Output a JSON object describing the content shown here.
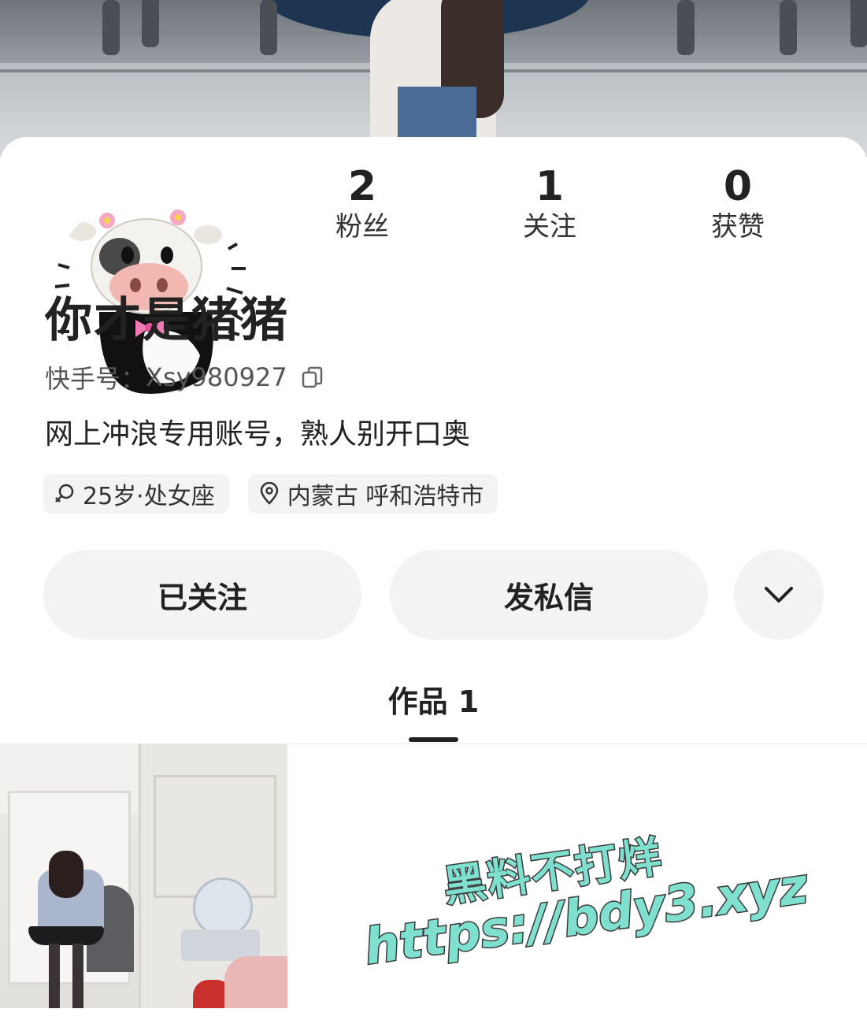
{
  "profile": {
    "nickname": "你才是猪猪",
    "kuaishou_id_label": "快手号：",
    "kuaishou_id": "Xsy980927",
    "bio": "网上冲浪专用账号，熟人别开口奥",
    "avatar_icon": "cow-avatar-icon"
  },
  "stats": [
    {
      "value": "2",
      "label": "粉丝"
    },
    {
      "value": "1",
      "label": "关注"
    },
    {
      "value": "0",
      "label": "获赞"
    }
  ],
  "tags": {
    "age_sign": "25岁·处女座",
    "location": "内蒙古 呼和浩特市"
  },
  "actions": {
    "follow_label": "已关注",
    "message_label": "发私信"
  },
  "tabs": {
    "works_label": "作品 1"
  },
  "watermark": {
    "line1": "黑料不打烊",
    "line2": "https://bdy3.xyz"
  },
  "colors": {
    "accent_text": "#222222",
    "chip_bg": "#f3f3f3",
    "watermark": "#7fe0cf"
  }
}
